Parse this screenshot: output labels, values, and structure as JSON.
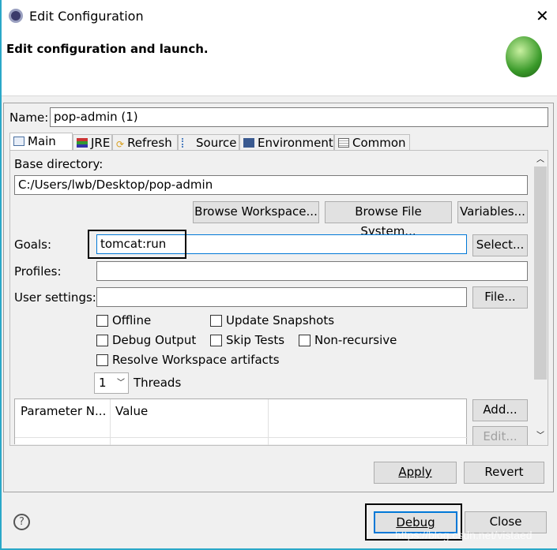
{
  "window": {
    "title": "Edit Configuration",
    "header": "Edit configuration and launch."
  },
  "name": {
    "label": "Name:",
    "value": "pop-admin (1)"
  },
  "tabs": [
    {
      "label": "Main",
      "active": true
    },
    {
      "label": "JRE"
    },
    {
      "label": "Refresh"
    },
    {
      "label": "Source"
    },
    {
      "label": "Environment"
    },
    {
      "label": "Common"
    }
  ],
  "main": {
    "base_dir_label": "Base directory:",
    "base_dir_value": "C:/Users/lwb/Desktop/pop-admin",
    "browse_workspace": "Browse Workspace...",
    "browse_fs": "Browse File System...",
    "variables": "Variables...",
    "goals_label": "Goals:",
    "goals_value": "tomcat:run",
    "select": "Select...",
    "profiles_label": "Profiles:",
    "profiles_value": "",
    "user_settings_label": "User settings:",
    "user_settings_value": "",
    "file": "File...",
    "checkboxes": {
      "offline": "Offline",
      "update_snapshots": "Update Snapshots",
      "debug_output": "Debug Output",
      "skip_tests": "Skip Tests",
      "non_recursive": "Non-recursive",
      "resolve_workspace": "Resolve Workspace artifacts"
    },
    "threads_value": "1",
    "threads_label": "Threads",
    "table": {
      "columns": [
        "Parameter N...",
        "Value"
      ]
    },
    "add": "Add...",
    "edit": "Edit..."
  },
  "buttons": {
    "apply": "Apply",
    "revert": "Revert",
    "debug": "Debug",
    "close": "Close",
    "help": "?"
  },
  "watermark": "https://blog.csdn.net/vistaed",
  "colors": {
    "focus": "#0078d7",
    "window_border": "#2aa8c8"
  }
}
